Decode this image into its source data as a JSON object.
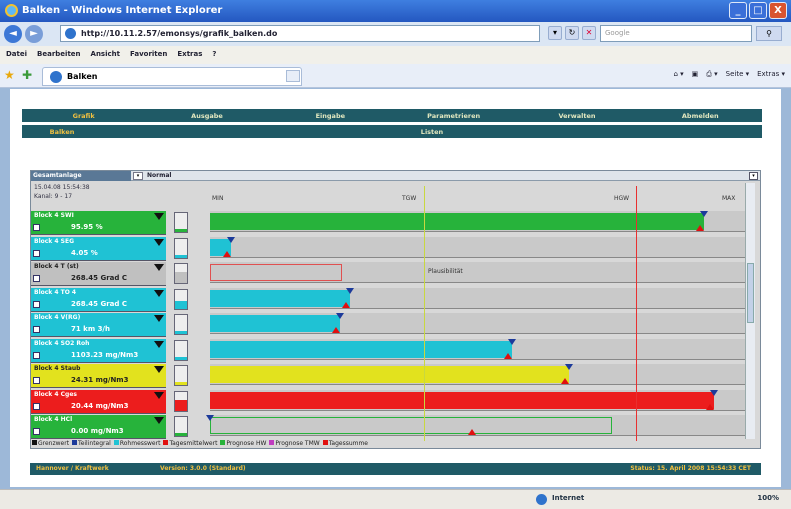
{
  "window": {
    "title": "Balken - Windows Internet Explorer",
    "controls": [
      "_",
      "□",
      "X"
    ]
  },
  "address": {
    "url": "http://10.11.2.57/emonsys/grafik_balken.do",
    "search_placeholder": "Google",
    "nav_back": "◄",
    "nav_fwd": "►"
  },
  "menu": {
    "items": [
      "Datei",
      "Bearbeiten",
      "Ansicht",
      "Favoriten",
      "Extras",
      "?"
    ]
  },
  "tab": {
    "label": "Balken"
  },
  "commands": {
    "items": [
      "Seite ▾",
      "Extras ▾"
    ]
  },
  "topnav": {
    "items": [
      "Grafik",
      "Ausgabe",
      "Eingabe",
      "Parametrieren",
      "Verwalten",
      "Abmelden"
    ]
  },
  "subnav": {
    "left": "Balken",
    "center": "Listen"
  },
  "panel": {
    "header_left": "Gesamtanlage",
    "header_mode": "Normal",
    "timestamp": "15.04.08 15:54:38",
    "kanal": "Kanal: 9 - 17",
    "axis": {
      "ticks": [
        "MIN",
        "TGW",
        "HGW",
        "MAX"
      ],
      "plausibility": "Plausibilität"
    },
    "colors": {
      "green": "#27b33b",
      "cyan": "#1fc2d4",
      "yellow": "#e2e21e",
      "red": "#ec1d1d",
      "grey": "#c0c0c0"
    },
    "blocks": [
      {
        "line1": "Block 4  SWI",
        "line2": "95.95  %",
        "color": "green",
        "pct": 0.95
      },
      {
        "line1": "Block 4  SEG",
        "line2": "4.05  %",
        "color": "cyan",
        "pct": 0.04
      },
      {
        "line1": "Block 4  T (st)",
        "line2": "268.45  Grad C",
        "color": "grey",
        "pct": 0.0
      },
      {
        "line1": "Block 4  TO 4",
        "line2": "268.45  Grad C",
        "color": "cyan",
        "pct": 0.27
      },
      {
        "line1": "Block 4  V(RG)",
        "line2": "71  km 3/h",
        "color": "cyan",
        "pct": 0.25
      },
      {
        "line1": "Block 4  SO2 Roh",
        "line2": "1103.23  mg/Nm3",
        "color": "cyan",
        "pct": 0.58
      },
      {
        "line1": "Block 4  Staub",
        "line2": "24.31  mg/Nm3",
        "color": "yellow",
        "pct": 0.69
      },
      {
        "line1": "Block 4  Cges",
        "line2": "20.44  mg/Nm3",
        "color": "red",
        "pct": 0.97
      },
      {
        "line1": "Block 4  HCl",
        "line2": "0.00  mg/Nm3",
        "color": "green",
        "pct": 0.0
      }
    ],
    "legend": [
      "Grenzwert",
      "Teilintegral",
      "Rohmesswert",
      "Tagesmittelwert",
      "Prognose HW",
      "Prognose TMW",
      "Tagessumme"
    ],
    "status_left": "Hannover / Kraftwerk",
    "status_mid": "Version: 3.0.0  (Standard)",
    "status_right": "Status: 15. April 2008 15:54:33 CET"
  },
  "ie_status": {
    "zone": "Internet",
    "zoom": "100%"
  }
}
